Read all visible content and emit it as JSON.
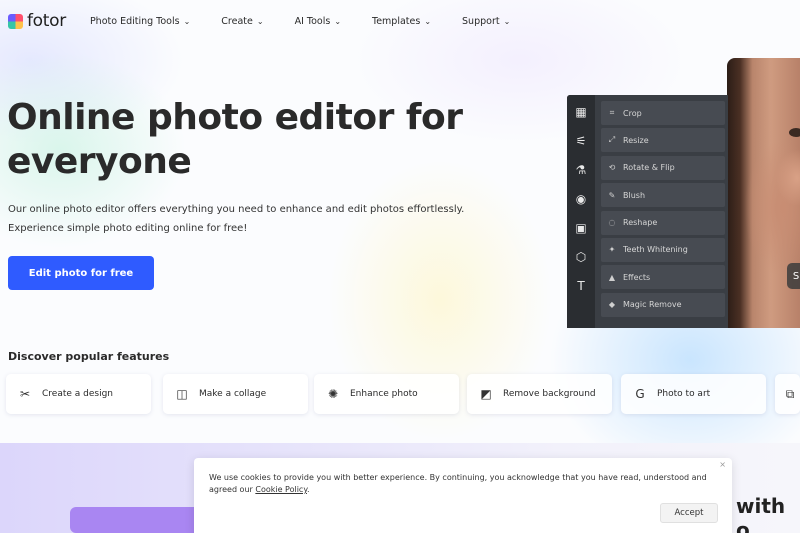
{
  "header": {
    "logo_text": "fotor",
    "nav": [
      {
        "label": "Photo Editing Tools"
      },
      {
        "label": "Create"
      },
      {
        "label": "AI Tools"
      },
      {
        "label": "Templates"
      },
      {
        "label": "Support"
      }
    ]
  },
  "hero": {
    "title": "Online photo editor for everyone",
    "subtitle_line1": "Our online photo editor offers everything you need to enhance and edit photos effortlessly.",
    "subtitle_line2": "Experience simple photo editing online for free!",
    "cta_label": "Edit photo for free"
  },
  "editor": {
    "rail_icons": [
      "grid-icon",
      "sliders-icon",
      "flask-icon",
      "eye-icon",
      "frame-icon",
      "shapes-icon",
      "text-icon"
    ],
    "items": [
      {
        "label": "Crop",
        "icon": "crop-icon"
      },
      {
        "label": "Resize",
        "icon": "resize-icon"
      },
      {
        "label": "Rotate & Flip",
        "icon": "rotate-icon"
      },
      {
        "label": "Blush",
        "icon": "blush-icon"
      },
      {
        "label": "Reshape",
        "icon": "reshape-icon"
      },
      {
        "label": "Teeth Whitening",
        "icon": "teeth-icon"
      },
      {
        "label": "Effects",
        "icon": "effects-icon"
      },
      {
        "label": "Magic Remove",
        "icon": "eraser-icon"
      }
    ]
  },
  "features": {
    "title": "Discover popular features",
    "items": [
      {
        "label": "Create a design",
        "icon": "design-icon"
      },
      {
        "label": "Make a collage",
        "icon": "collage-icon"
      },
      {
        "label": "Enhance photo",
        "icon": "enhance-icon"
      },
      {
        "label": "Remove background",
        "icon": "remove-bg-icon"
      },
      {
        "label": "Photo to art",
        "icon": "art-icon"
      }
    ]
  },
  "band": {
    "partial_text": "with o"
  },
  "cookie": {
    "text": "We use cookies to provide you with better experience. By continuing, you acknowledge that you have read, understood and agreed our",
    "link_label": "Cookie Policy",
    "suffix": ".",
    "accept_label": "Accept",
    "close_label": "×"
  },
  "colors": {
    "accent": "#2f5bff",
    "editor_bg": "#3a3e44",
    "band_purple": "#a986f2"
  }
}
